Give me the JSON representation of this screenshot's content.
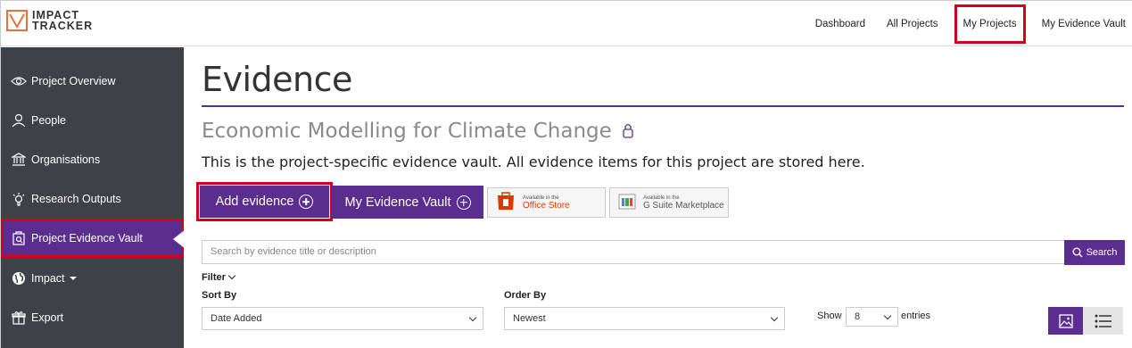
{
  "brand": {
    "line1": "IMPACT",
    "line2": "TRACKER",
    "accent": "#e8703a"
  },
  "colors": {
    "primary": "#5b2d8e",
    "sidebar": "#3e4248",
    "highlight": "#d0021b"
  },
  "nav": {
    "dashboard": "Dashboard",
    "all_projects": "All Projects",
    "my_projects": "My Projects",
    "my_evidence_vault": "My Evidence Vault"
  },
  "sidebar": {
    "items": [
      {
        "label": "Project Overview",
        "icon": "eye-icon"
      },
      {
        "label": "People",
        "icon": "person-icon"
      },
      {
        "label": "Organisations",
        "icon": "bank-icon"
      },
      {
        "label": "Research Outputs",
        "icon": "lightbulb-icon"
      },
      {
        "label": "Project Evidence Vault",
        "icon": "vault-search-icon",
        "active": true
      },
      {
        "label": "Impact",
        "icon": "globe-icon"
      },
      {
        "label": "Export",
        "icon": "gift-icon"
      }
    ]
  },
  "main": {
    "title": "Evidence",
    "project_name": "Economic Modelling for Climate Change",
    "description": "This is the project-specific evidence vault. All evidence items for this project are stored here.",
    "add_evidence": "Add evidence",
    "my_evidence_vault": "My Evidence Vault",
    "office_store": {
      "small": "Available in the",
      "big": "Office Store"
    },
    "gsuite": {
      "small": "Available in the",
      "big": "G Suite Marketplace"
    }
  },
  "search": {
    "placeholder": "Search by evidence title or description",
    "button": "Search"
  },
  "filters": {
    "filter_label": "Filter",
    "sort_by_label": "Sort By",
    "sort_by_value": "Date Added",
    "order_by_label": "Order By",
    "order_by_value": "Newest",
    "show_label": "Show",
    "show_value": "8",
    "entries_label": "entries"
  }
}
